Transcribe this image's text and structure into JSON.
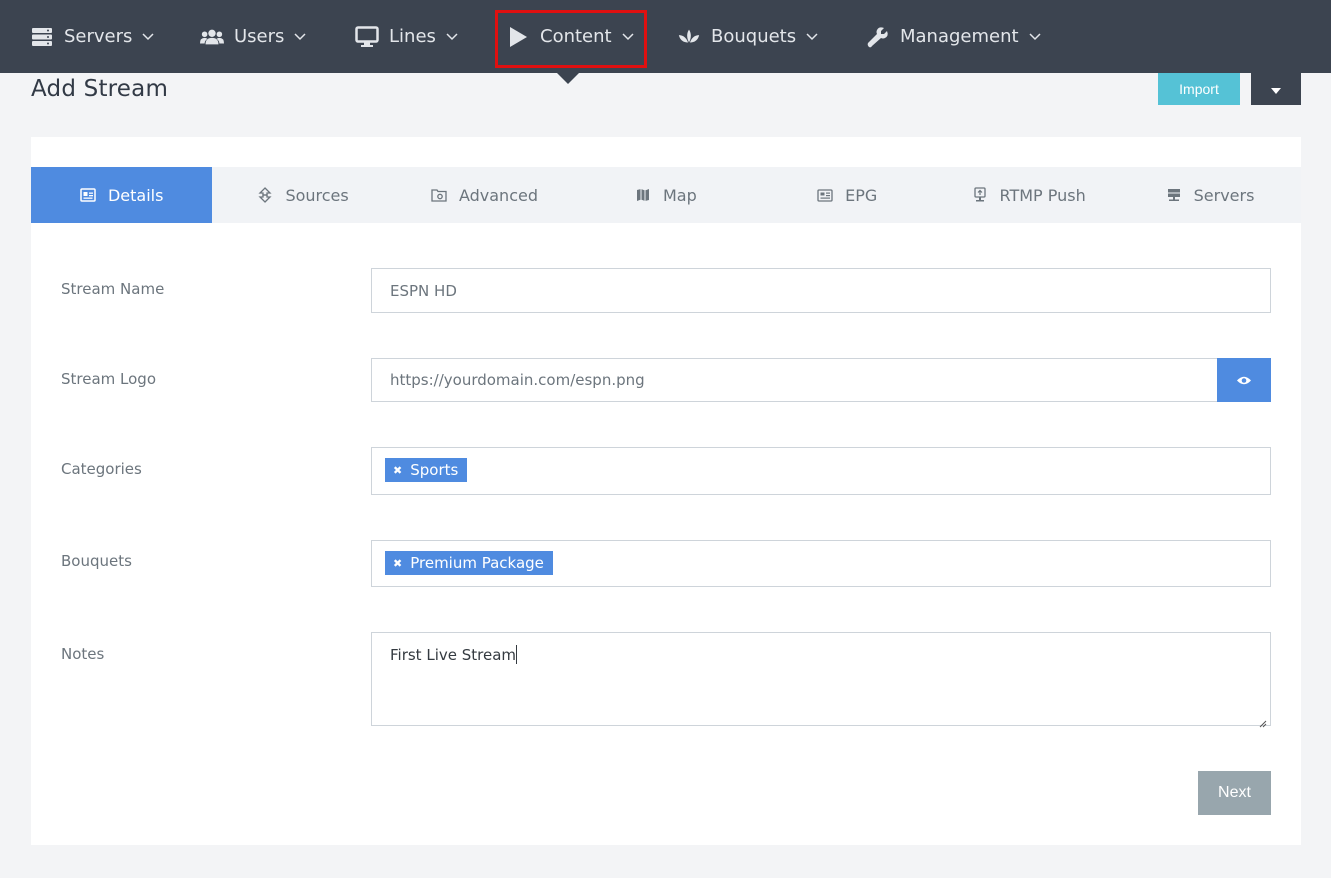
{
  "nav": {
    "items": [
      {
        "label": "Servers",
        "icon": "server-icon"
      },
      {
        "label": "Users",
        "icon": "users-icon"
      },
      {
        "label": "Lines",
        "icon": "monitor-icon"
      },
      {
        "label": "Content",
        "icon": "play-icon"
      },
      {
        "label": "Bouquets",
        "icon": "lotus-icon"
      },
      {
        "label": "Management",
        "icon": "wrench-icon"
      }
    ],
    "highlight_color": "#e01010"
  },
  "page": {
    "title": "Add Stream",
    "import_label": "Import"
  },
  "tabs": [
    {
      "label": "Details",
      "icon": "id-card-icon",
      "active": true
    },
    {
      "label": "Sources",
      "icon": "arrows-icon",
      "active": false
    },
    {
      "label": "Advanced",
      "icon": "folder-cog-icon",
      "active": false
    },
    {
      "label": "Map",
      "icon": "map-icon",
      "active": false
    },
    {
      "label": "EPG",
      "icon": "newspaper-icon",
      "active": false
    },
    {
      "label": "RTMP Push",
      "icon": "upload-monitor-icon",
      "active": false
    },
    {
      "label": "Servers",
      "icon": "server-icon",
      "active": false
    }
  ],
  "form": {
    "stream_name": {
      "label": "Stream Name",
      "value": "ESPN HD"
    },
    "stream_logo": {
      "label": "Stream Logo",
      "value": "https://yourdomain.com/espn.png"
    },
    "categories": {
      "label": "Categories",
      "tags": [
        "Sports"
      ]
    },
    "bouquets": {
      "label": "Bouquets",
      "tags": [
        "Premium Package"
      ]
    },
    "notes": {
      "label": "Notes",
      "value": "First Live Stream"
    },
    "next_label": "Next"
  },
  "colors": {
    "navbar": "#3c4450",
    "primary": "#4f8be0",
    "info": "#55c2d6",
    "secondary": "#98a6ad"
  }
}
